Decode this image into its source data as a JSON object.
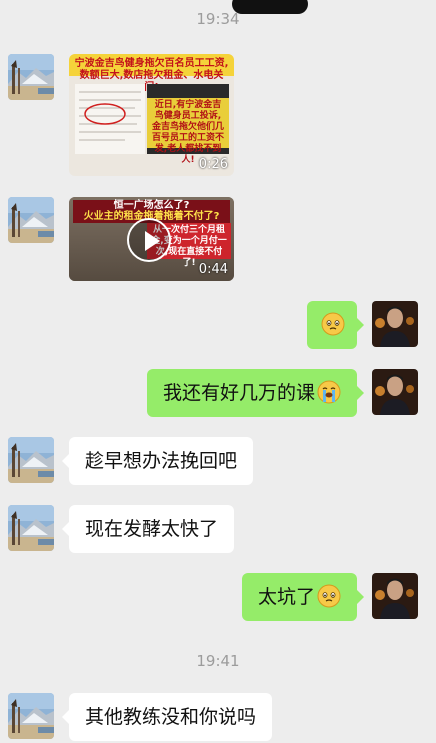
{
  "timestamps": [
    "19:34",
    "19:41"
  ],
  "messages": {
    "video1": {
      "caption_top": "宁波金吉鸟健身拖欠百名员工工资,数额巨大,数店拖欠租金、水电关门!",
      "caption_box": "近日,有宁波金吉鸟健身员工投诉,金吉鸟拖欠他们几百号员工的工资不发,老人都找不到人!",
      "duration": "0:26"
    },
    "video2": {
      "caption_top": "恒一广场怎么了?",
      "caption_top2": "火业主的租金拖着拖着不付了?",
      "caption_box": "从一次付三个月租金,变为一个月付一次,现在直接不付了!",
      "duration": "0:44"
    },
    "m1": {
      "emoji": "worried-face-emoji"
    },
    "m2": {
      "text": "我还有好几万的课",
      "emoji": "crying-face-emoji"
    },
    "m3": {
      "text": "趁早想办法挽回吧"
    },
    "m4": {
      "text": "现在发酵太快了"
    },
    "m5": {
      "text": "太坑了",
      "emoji": "worried-face-emoji"
    },
    "m6": {
      "text": "其他教练没和你说吗"
    }
  },
  "colors": {
    "background": "#ededed",
    "outgoing_bubble": "#95ec69",
    "incoming_bubble": "#ffffff",
    "timestamp": "#9c9c9c"
  }
}
